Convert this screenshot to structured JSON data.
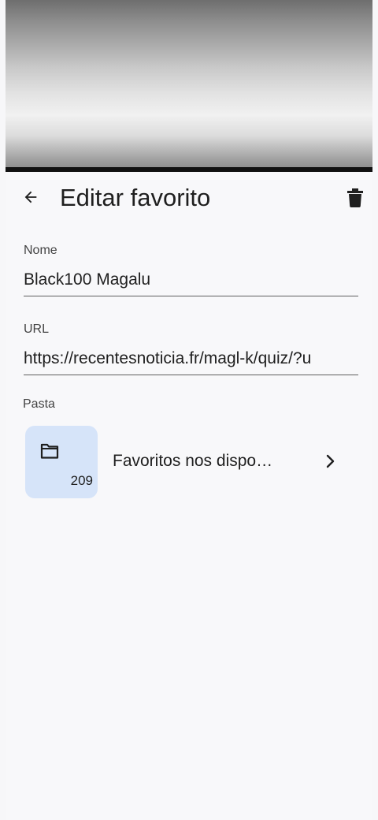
{
  "header": {
    "title": "Editar favorito",
    "back_icon": "arrow-left-icon",
    "delete_icon": "trash-icon"
  },
  "fields": {
    "name": {
      "label": "Nome",
      "value": "Black100 Magalu"
    },
    "url": {
      "label": "URL",
      "value": "https://recentesnoticia.fr/magl-k/quiz/?u"
    }
  },
  "folder": {
    "label": "Pasta",
    "name": "Favoritos nos dispo…",
    "count": "209",
    "icon": "folder-icon",
    "chevron_icon": "chevron-right-icon",
    "tile_color": "#d6e4f9"
  }
}
